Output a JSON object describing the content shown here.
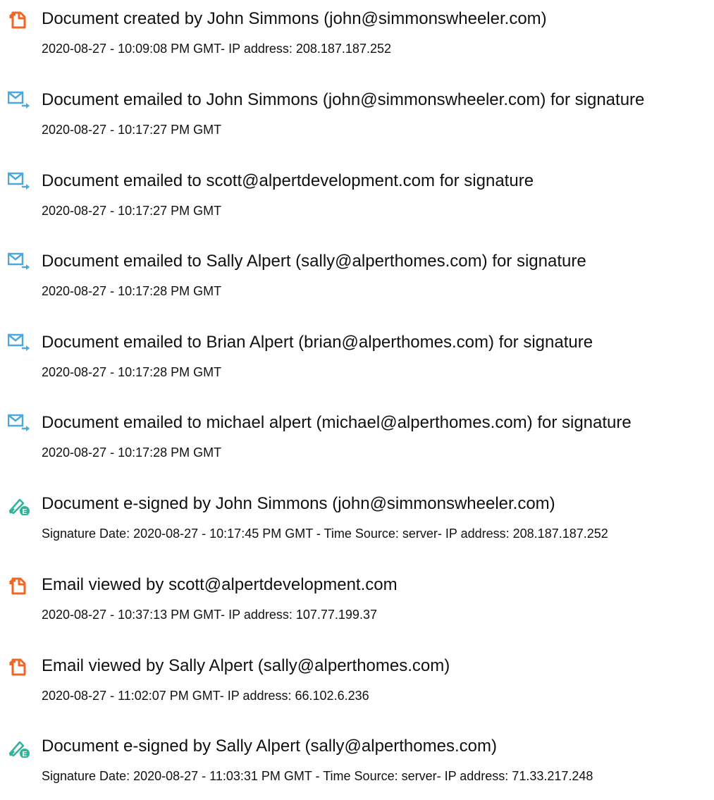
{
  "colors": {
    "doc_icon": "#f26522",
    "email_icon": "#4aa8df",
    "sign_icon": "#2fb39b",
    "text": "#111111"
  },
  "entries": [
    {
      "icon": "document-icon",
      "title": "Document created by John Simmons (john@simmonswheeler.com)",
      "detail": "2020-08-27 - 10:09:08 PM GMT- IP address: 208.187.187.252"
    },
    {
      "icon": "email-sent-icon",
      "title": "Document emailed to John Simmons (john@simmonswheeler.com) for signature",
      "detail": "2020-08-27 - 10:17:27 PM GMT"
    },
    {
      "icon": "email-sent-icon",
      "title": "Document emailed to scott@alpertdevelopment.com for signature",
      "detail": "2020-08-27 - 10:17:27 PM GMT"
    },
    {
      "icon": "email-sent-icon",
      "title": "Document emailed to Sally Alpert (sally@alperthomes.com) for signature",
      "detail": "2020-08-27 - 10:17:28 PM GMT"
    },
    {
      "icon": "email-sent-icon",
      "title": "Document emailed to Brian Alpert (brian@alperthomes.com) for signature",
      "detail": "2020-08-27 - 10:17:28 PM GMT"
    },
    {
      "icon": "email-sent-icon",
      "title": "Document emailed to michael alpert (michael@alperthomes.com) for signature",
      "detail": "2020-08-27 - 10:17:28 PM GMT"
    },
    {
      "icon": "e-sign-icon",
      "title": "Document e-signed by John Simmons (john@simmonswheeler.com)",
      "detail": "Signature Date: 2020-08-27 - 10:17:45 PM GMT - Time Source: server- IP address: 208.187.187.252"
    },
    {
      "icon": "document-icon",
      "title": "Email viewed by scott@alpertdevelopment.com",
      "detail": "2020-08-27 - 10:37:13 PM GMT- IP address: 107.77.199.37"
    },
    {
      "icon": "document-icon",
      "title": "Email viewed by Sally Alpert (sally@alperthomes.com)",
      "detail": "2020-08-27 - 11:02:07 PM GMT- IP address: 66.102.6.236"
    },
    {
      "icon": "e-sign-icon",
      "title": "Document e-signed by Sally Alpert (sally@alperthomes.com)",
      "detail": "Signature Date: 2020-08-27 - 11:03:31 PM GMT - Time Source: server- IP address: 71.33.217.248"
    }
  ]
}
